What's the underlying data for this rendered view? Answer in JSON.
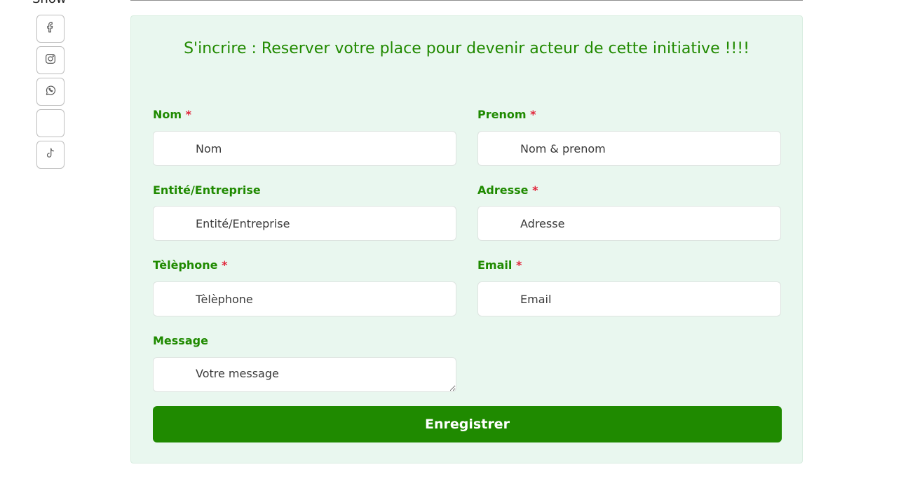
{
  "share": {
    "label": "Show",
    "icons": [
      "facebook-icon",
      "instagram-icon",
      "whatsapp-icon",
      "blank-icon",
      "tiktok-icon"
    ]
  },
  "form": {
    "title": "S'incrire : Reserver votre place pour devenir acteur de cette initiative !!!!",
    "fields": {
      "nom": {
        "label": "Nom",
        "required_mark": "*",
        "placeholder": "Nom"
      },
      "prenom": {
        "label": "Prenom",
        "required_mark": "*",
        "placeholder": "Nom & prenom"
      },
      "entite": {
        "label": "Entité/Entreprise",
        "placeholder": "Entité/Entreprise"
      },
      "adresse": {
        "label": "Adresse",
        "required_mark": "*",
        "placeholder": "Adresse"
      },
      "telephone": {
        "label": "Tèlèphone",
        "required_mark": "*",
        "placeholder": "Tèlèphone"
      },
      "email": {
        "label": "Email",
        "required_mark": "*",
        "placeholder": "Email"
      },
      "message": {
        "label": "Message",
        "placeholder": "Votre message"
      }
    },
    "submit_label": "Enregistrer"
  },
  "colors": {
    "accent_green": "#218a00",
    "card_background": "#e9f7ef",
    "required_red": "#e1263b"
  }
}
